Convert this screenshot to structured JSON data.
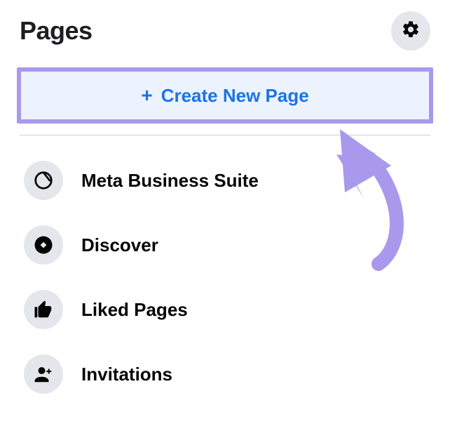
{
  "header": {
    "title": "Pages"
  },
  "create_button": {
    "label": "Create New Page"
  },
  "items": [
    {
      "icon": "meta-suite",
      "label": "Meta Business Suite"
    },
    {
      "icon": "discover",
      "label": "Discover"
    },
    {
      "icon": "like",
      "label": "Liked Pages"
    },
    {
      "icon": "invite",
      "label": "Invitations"
    }
  ],
  "colors": {
    "highlight_border": "#a999ec",
    "accent": "#1b74e4",
    "annotation": "#a999ec"
  }
}
